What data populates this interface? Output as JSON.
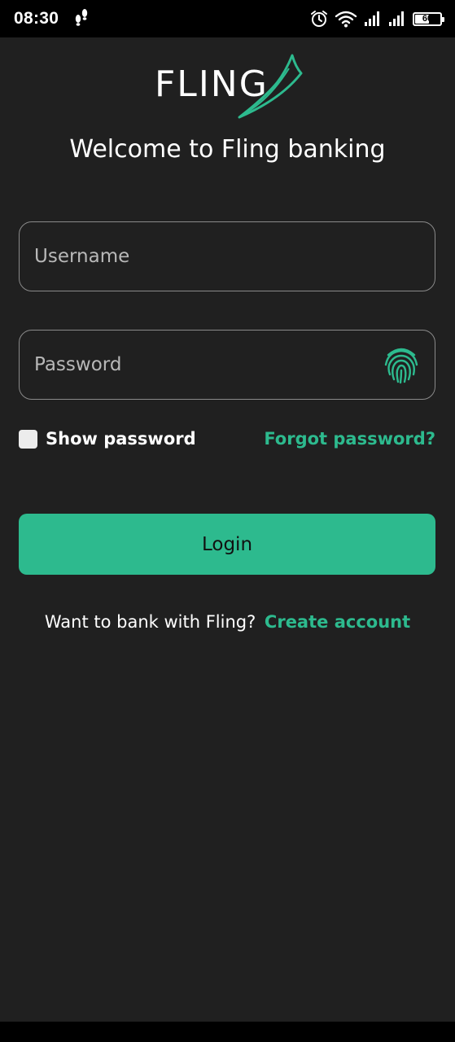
{
  "status_bar": {
    "time": "08:30",
    "battery_level": "60",
    "icons": [
      "footsteps-icon",
      "alarm-icon",
      "wifi-icon",
      "signal-icon",
      "signal-icon",
      "battery-icon"
    ]
  },
  "app": {
    "logo_text": "FLING",
    "welcome": "Welcome to Fling banking"
  },
  "form": {
    "username_placeholder": "Username",
    "password_placeholder": "Password",
    "show_password_label": "Show password",
    "show_password_checked": false,
    "forgot_password": "Forgot password?",
    "login_label": "Login"
  },
  "signup": {
    "prompt": "Want to bank with Fling?",
    "link": "Create account"
  },
  "colors": {
    "background": "#202020",
    "accent": "#2dba8e",
    "field_border": "#8a8a8a"
  }
}
